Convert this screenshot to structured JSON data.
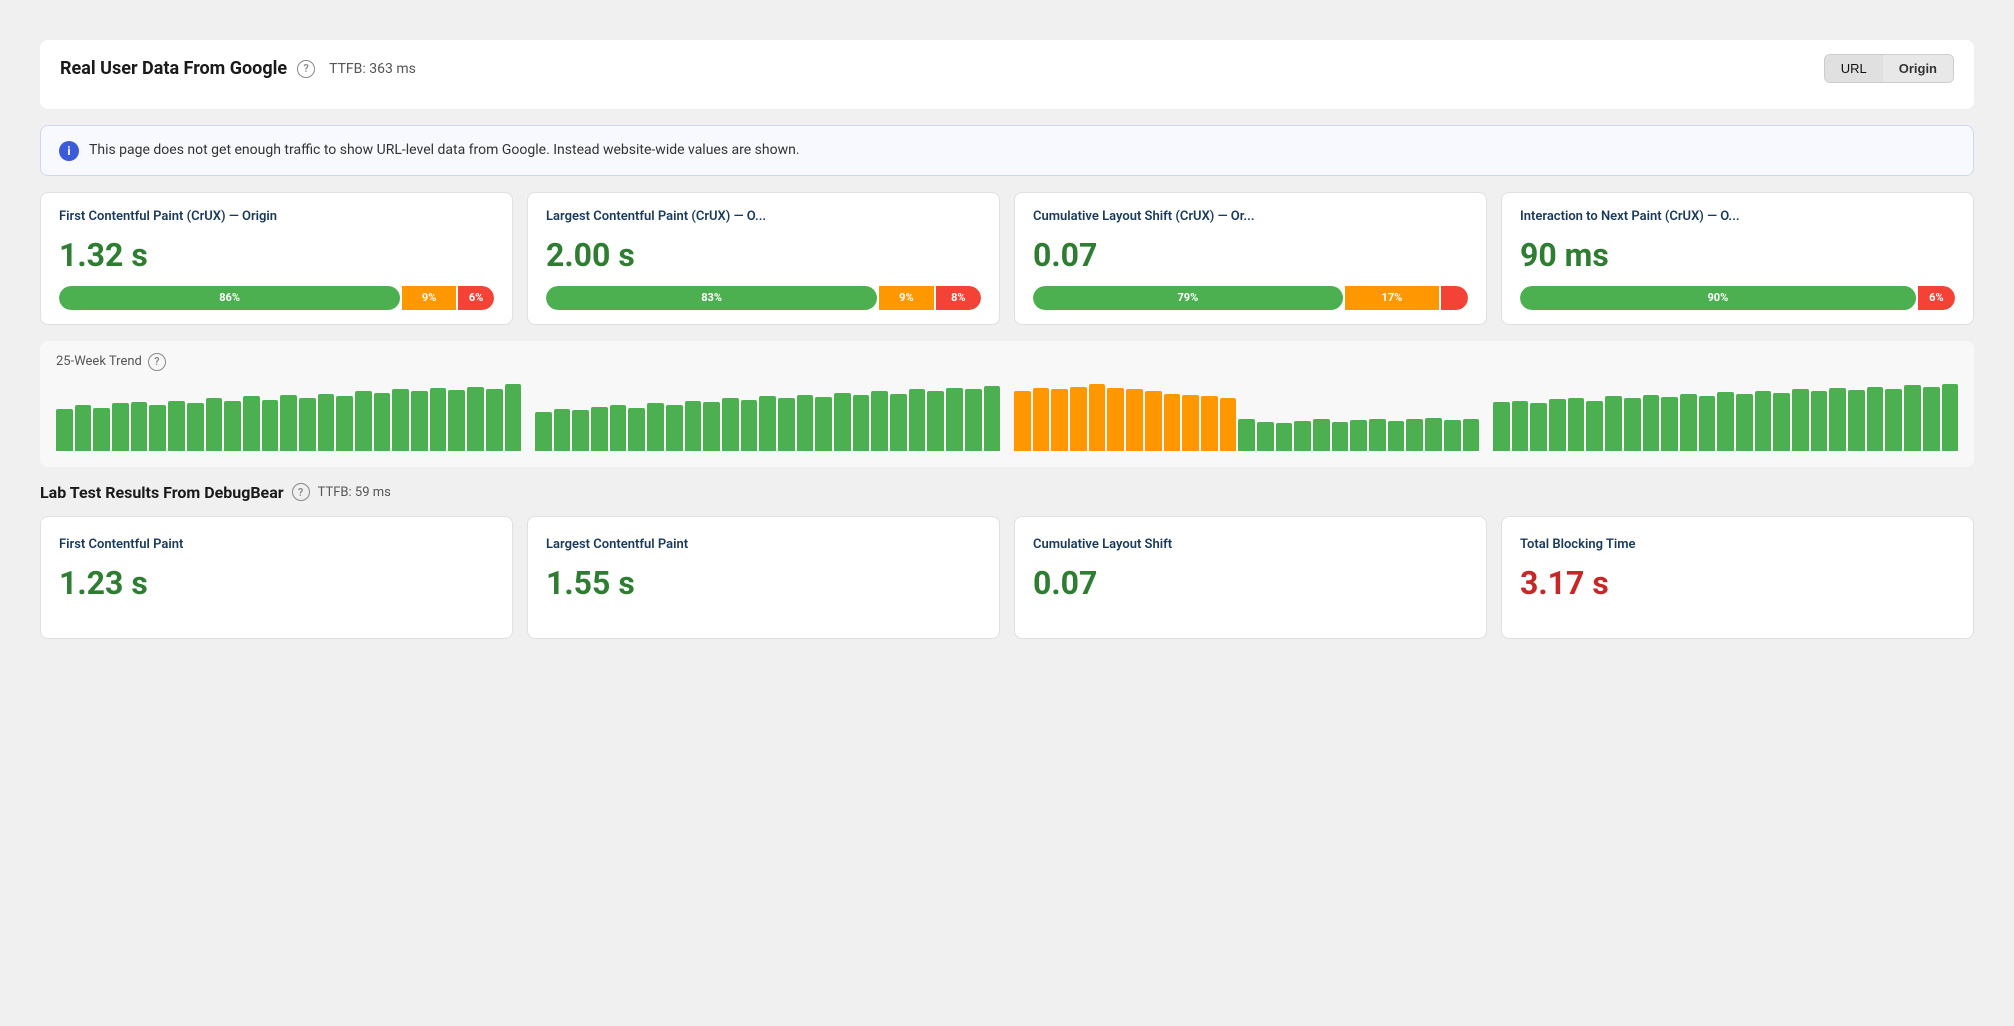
{
  "header": {
    "title": "Real User Data From Google",
    "ttfb": "TTFB: 363 ms",
    "toggle": {
      "url_label": "URL",
      "origin_label": "Origin",
      "active": "Origin"
    }
  },
  "info_banner": {
    "text": "This page does not get enough traffic to show URL-level data from Google. Instead website-wide values are shown."
  },
  "crux_metrics": [
    {
      "title": "First Contentful Paint (CrUX) — Origin",
      "value": "1.32 s",
      "green_pct": "86%",
      "orange_pct": "9%",
      "red_pct": "6%",
      "green_w": 76,
      "orange_w": 12,
      "red_w": 8,
      "bar_colors": [
        "green",
        "green",
        "green",
        "green",
        "green",
        "green",
        "green",
        "green",
        "green",
        "green",
        "green",
        "green",
        "green",
        "green",
        "green",
        "green",
        "green",
        "green",
        "green",
        "green",
        "green",
        "green",
        "green",
        "green",
        "green"
      ]
    },
    {
      "title": "Largest Contentful Paint (CrUX) — O...",
      "value": "2.00 s",
      "green_pct": "83%",
      "orange_pct": "9%",
      "red_pct": "8%",
      "green_w": 73,
      "orange_w": 12,
      "red_w": 10,
      "bar_colors": [
        "green",
        "green",
        "green",
        "green",
        "green",
        "green",
        "green",
        "green",
        "green",
        "green",
        "green",
        "green",
        "green",
        "green",
        "green",
        "green",
        "green",
        "green",
        "green",
        "green",
        "green",
        "green",
        "green",
        "green",
        "green"
      ]
    },
    {
      "title": "Cumulative Layout Shift (CrUX) — Or...",
      "value": "0.07",
      "green_pct": "79%",
      "orange_pct": "17%",
      "red_pct": "",
      "green_w": 69,
      "orange_w": 21,
      "red_w": 6,
      "bar_colors": [
        "orange",
        "orange",
        "orange",
        "orange",
        "orange",
        "orange",
        "orange",
        "orange",
        "orange",
        "orange",
        "orange",
        "orange",
        "orange",
        "green",
        "green",
        "green",
        "green",
        "green",
        "green",
        "green",
        "green",
        "green",
        "green",
        "green",
        "green"
      ]
    },
    {
      "title": "Interaction to Next Paint (CrUX) — O...",
      "value": "90 ms",
      "green_pct": "90%",
      "orange_pct": "",
      "red_pct": "6%",
      "green_w": 85,
      "orange_w": 0,
      "red_w": 8,
      "bar_colors": [
        "green",
        "green",
        "green",
        "green",
        "green",
        "green",
        "green",
        "green",
        "green",
        "green",
        "green",
        "green",
        "green",
        "green",
        "green",
        "green",
        "green",
        "green",
        "green",
        "green",
        "green",
        "green",
        "green",
        "green",
        "green"
      ]
    }
  ],
  "trend": {
    "label": "25-Week Trend"
  },
  "lab": {
    "title": "Lab Test Results From DebugBear",
    "ttfb": "TTFB: 59 ms",
    "metrics": [
      {
        "title": "First Contentful Paint",
        "value": "1.23 s",
        "value_color": "green"
      },
      {
        "title": "Largest Contentful Paint",
        "value": "1.55 s",
        "value_color": "green"
      },
      {
        "title": "Cumulative Layout Shift",
        "value": "0.07",
        "value_color": "green"
      },
      {
        "title": "Total Blocking Time",
        "value": "3.17 s",
        "value_color": "red"
      }
    ]
  },
  "icons": {
    "help": "?",
    "info": "i"
  }
}
